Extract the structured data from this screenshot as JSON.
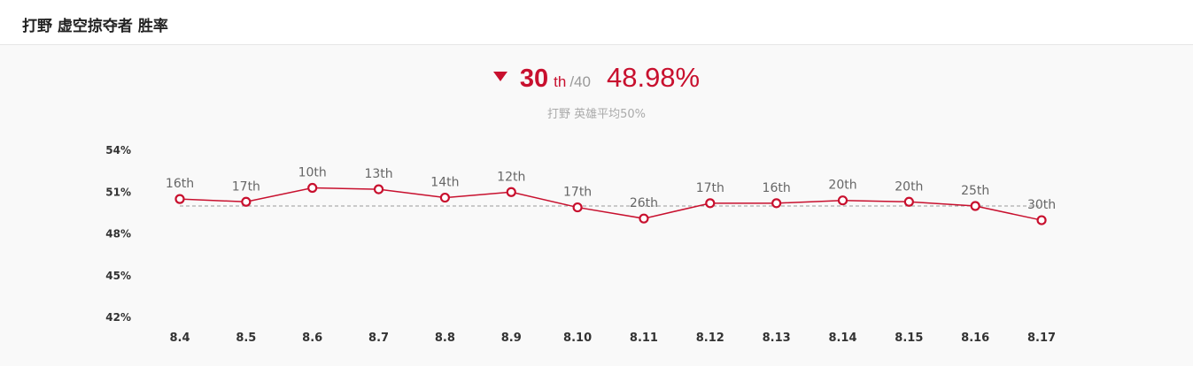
{
  "header": {
    "title": "打野 虚空掠夺者 胜率"
  },
  "summary": {
    "rank": "30",
    "rank_suffix": "th",
    "rank_total": "/40",
    "win_rate": "48.98%",
    "subtitle": "打野 英雄平均50%"
  },
  "colors": {
    "accent": "#c8102e",
    "avg_line": "#999999"
  },
  "icons": {
    "trend": "down-arrow-icon"
  },
  "chart_data": {
    "type": "line",
    "categories": [
      "8.4",
      "8.5",
      "8.6",
      "8.7",
      "8.8",
      "8.9",
      "8.10",
      "8.11",
      "8.12",
      "8.13",
      "8.14",
      "8.15",
      "8.16",
      "8.17"
    ],
    "series": [
      {
        "values": [
          50.5,
          50.3,
          51.3,
          51.2,
          50.6,
          51.0,
          49.9,
          49.1,
          50.2,
          50.2,
          50.4,
          50.3,
          50.0,
          48.98
        ],
        "labels": [
          "16th",
          "17th",
          "10th",
          "13th",
          "14th",
          "12th",
          "17th",
          "26th",
          "17th",
          "16th",
          "20th",
          "20th",
          "25th",
          "30th"
        ]
      }
    ],
    "yticks": [
      "54%",
      "51%",
      "48%",
      "45%",
      "42%"
    ],
    "ylim": [
      42,
      54
    ],
    "average": 50,
    "grid": false
  }
}
